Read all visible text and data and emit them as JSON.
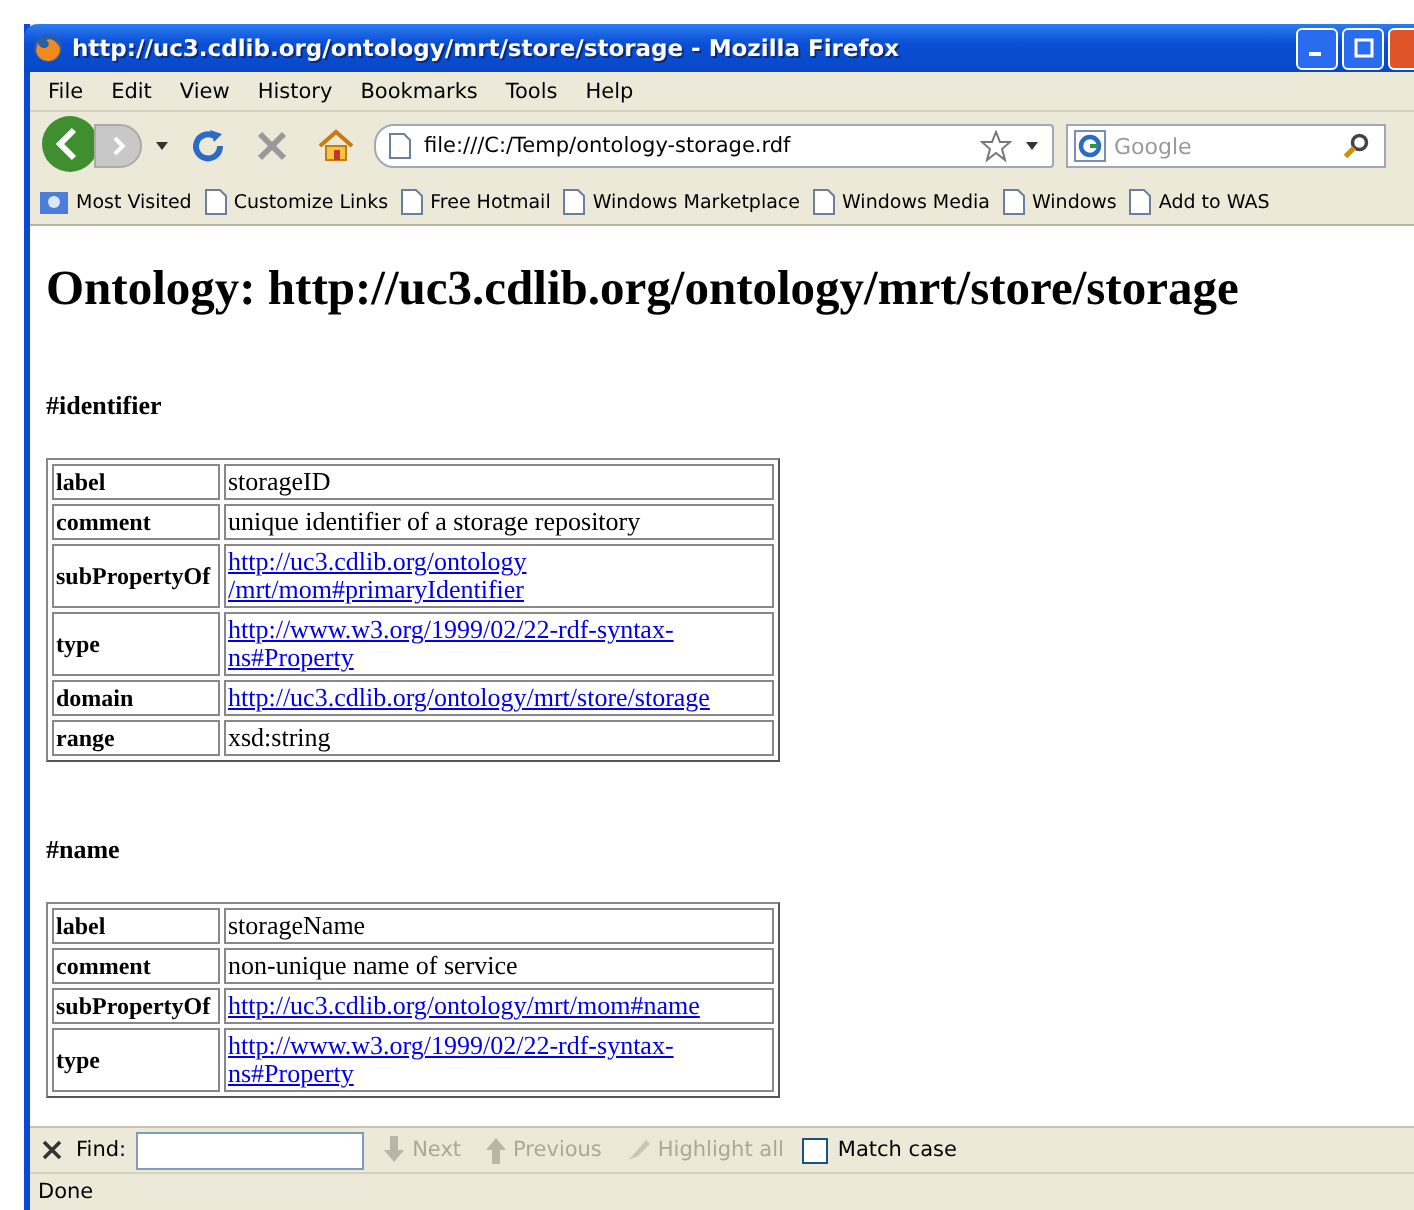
{
  "window": {
    "title": "http://uc3.cdlib.org/ontology/mrt/store/storage - Mozilla Firefox"
  },
  "menu": [
    "File",
    "Edit",
    "View",
    "History",
    "Bookmarks",
    "Tools",
    "Help"
  ],
  "address_bar": {
    "value": "file:///C:/Temp/ontology-storage.rdf"
  },
  "search": {
    "placeholder": "Google"
  },
  "bookmarks": [
    {
      "label": "Most Visited",
      "kind": "folder"
    },
    {
      "label": "Customize Links",
      "kind": "page"
    },
    {
      "label": "Free Hotmail",
      "kind": "page"
    },
    {
      "label": "Windows Marketplace",
      "kind": "page"
    },
    {
      "label": "Windows Media",
      "kind": "page"
    },
    {
      "label": "Windows",
      "kind": "page"
    },
    {
      "label": "Add to WAS",
      "kind": "page"
    }
  ],
  "page": {
    "heading": "Ontology: http://uc3.cdlib.org/ontology/mrt/store/storage",
    "sections": [
      {
        "title": "#identifier",
        "rows": [
          {
            "key": "label",
            "value": "storageID",
            "link": false
          },
          {
            "key": "comment",
            "value": "unique identifier of a storage repository",
            "link": false
          },
          {
            "key": "subPropertyOf",
            "value": "http://uc3.cdlib.org/ontology /mrt/mom#primaryIdentifier",
            "link": true
          },
          {
            "key": "type",
            "value": "http://www.w3.org/1999/02/22-rdf-syntax-ns#Property",
            "link": true
          },
          {
            "key": "domain",
            "value": "http://uc3.cdlib.org/ontology/mrt/store/storage",
            "link": true
          },
          {
            "key": "range",
            "value": "xsd:string",
            "link": false
          }
        ]
      },
      {
        "title": "#name",
        "rows": [
          {
            "key": "label",
            "value": "storageName",
            "link": false
          },
          {
            "key": "comment",
            "value": "non-unique name of service",
            "link": false
          },
          {
            "key": "subPropertyOf",
            "value": "http://uc3.cdlib.org/ontology/mrt/mom#name",
            "link": true
          },
          {
            "key": "type",
            "value": "http://www.w3.org/1999/02/22-rdf-syntax-ns#Property",
            "link": true
          }
        ]
      }
    ]
  },
  "find_bar": {
    "label": "Find:",
    "buttons": [
      {
        "label": "Next",
        "disabled": true
      },
      {
        "label": "Previous",
        "disabled": true
      },
      {
        "label": "Highlight all",
        "disabled": true
      }
    ],
    "match_case": {
      "label": "Match case",
      "checked": false
    }
  },
  "status_bar": "Done"
}
